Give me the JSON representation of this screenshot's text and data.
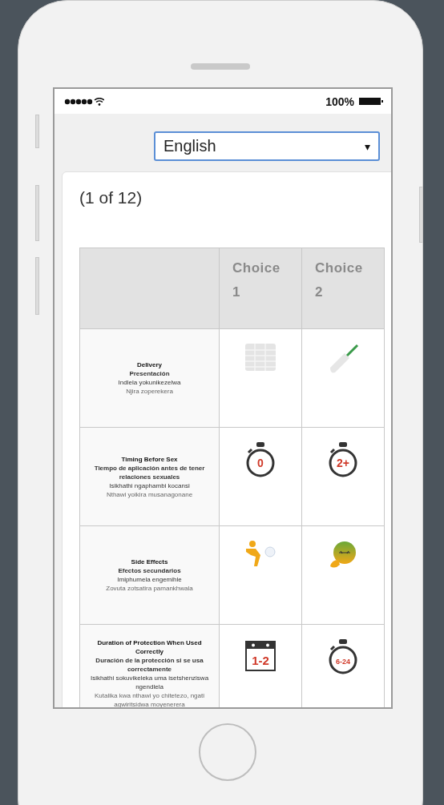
{
  "status_bar": {
    "battery_text": "100%"
  },
  "language_select": {
    "value": "English",
    "caret": "▾"
  },
  "card": {
    "progress": "(1 of 12)",
    "table": {
      "columns": [
        "Choice 1",
        "Choice 2"
      ],
      "rows": [
        {
          "label": [
            "Delivery",
            "Presentación",
            "Indlela yokunikezelwa",
            "Njira zoperekera"
          ],
          "choices": [
            {
              "kind": "grid"
            },
            {
              "kind": "applicator"
            }
          ]
        },
        {
          "label": [
            "Timing Before Sex",
            "Tiempo de aplicación antes de tener relaciones sexuales",
            "Isikhathi ngaphambi kocansi",
            "Nthawi yoikira musanagonane"
          ],
          "choices": [
            {
              "kind": "stopwatch",
              "figure": "0"
            },
            {
              "kind": "stopwatch",
              "figure": "2+"
            }
          ]
        },
        {
          "label": [
            "Side Effects",
            "Efectos secundarios",
            "Imiphumela engemihle",
            "Zovuta zotsatira pamankhwala"
          ],
          "choices": [
            {
              "kind": "person"
            },
            {
              "kind": "nausea"
            }
          ]
        },
        {
          "label": [
            "Duration of Protection When Used Correctly",
            "Duración de la protección si se usa correctamente",
            "Isikhathi sokuvikeleka uma isetshenziswa ngendlela",
            "Kutalika kwa nthawi yo chitetezo, ngati agwiritsidwa moyenerera"
          ],
          "choices": [
            {
              "kind": "calendar",
              "figure": "1-2"
            },
            {
              "kind": "stopwatch",
              "figure": "6-24"
            }
          ]
        }
      ]
    }
  }
}
